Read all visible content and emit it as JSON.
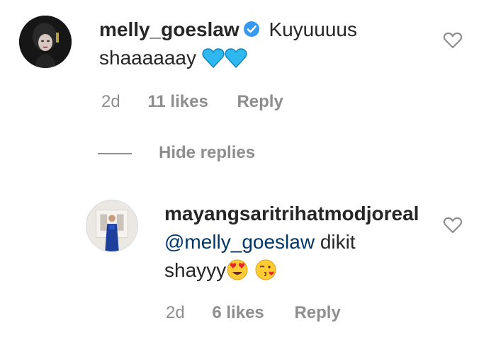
{
  "comment": {
    "username": "melly_goeslaw",
    "verified_icon": "verified-badge-icon",
    "text_line1": "Kuyuuuus",
    "text_line2": "shaaaaaay",
    "emojis": [
      "blue-heart-icon",
      "blue-heart-icon"
    ],
    "time": "2d",
    "likes": "11 likes",
    "reply_label": "Reply",
    "like_icon": "heart-outline-icon"
  },
  "replies_toggle": {
    "label": "Hide replies"
  },
  "reply": {
    "username": "mayangsaritrihatmodjoreal",
    "mention": "@melly_goeslaw",
    "text_after_mention": " dikit",
    "text_line2": "shayyy",
    "emojis": [
      "heart-eyes-emoji-icon",
      "kissing-face-emoji-icon"
    ],
    "time": "2d",
    "likes": "6 likes",
    "reply_label": "Reply",
    "like_icon": "heart-outline-icon"
  },
  "colors": {
    "text": "#262626",
    "meta": "#8e8e8e",
    "mention": "#00376b",
    "verified": "#3897f0",
    "blue_heart": "#2fb8f0"
  }
}
